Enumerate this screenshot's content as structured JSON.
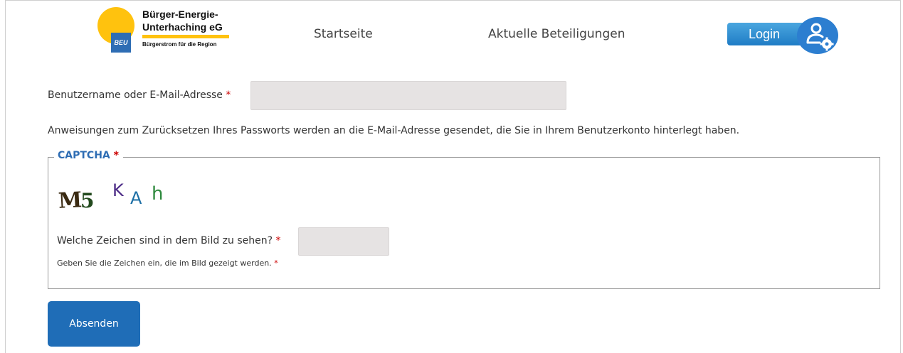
{
  "header": {
    "logo": {
      "badge": "BEU",
      "line1": "Bürger-Energie-",
      "line2": "Unterhaching eG",
      "tagline": "Bürgerstrom für die Region"
    },
    "nav": [
      {
        "label": "Startseite"
      },
      {
        "label": "Aktuelle Beteiligungen"
      }
    ],
    "login_label": "Login",
    "login_icon": "user-gear-icon"
  },
  "form": {
    "username_label": "Benutzername oder E-Mail-Adresse",
    "required_mark": "*",
    "username_value": "",
    "instructions": "Anweisungen zum Zurücksetzen Ihres Passworts werden an die E-Mail-Adresse gesendet, die Sie in Ihrem Benutzerkonto hinterlegt haben.",
    "captcha": {
      "legend": "CAPTCHA",
      "image_text": "M5 KAh",
      "question_label": "Welche Zeichen sind in dem Bild zu sehen?",
      "answer_value": "",
      "help_text": "Geben Sie die Zeichen ein, die im Bild gezeigt werden."
    },
    "submit_label": "Absenden"
  },
  "colors": {
    "brand_blue": "#1f6db7",
    "legend_blue": "#2e6db4",
    "sun_yellow": "#ffc20e",
    "required_red": "#cc0000",
    "input_bg": "#e6e3e3"
  }
}
